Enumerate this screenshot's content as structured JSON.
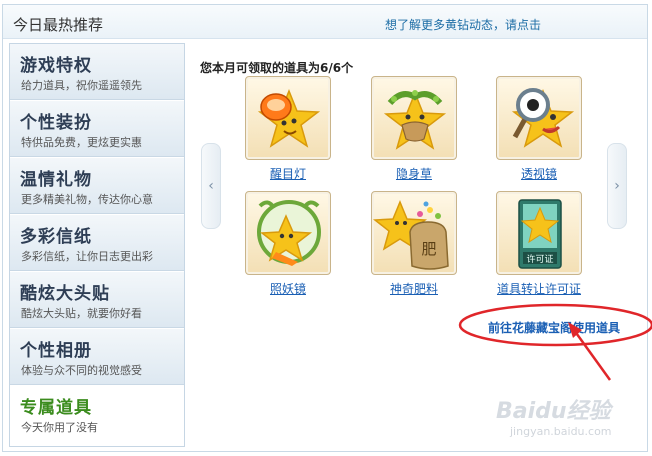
{
  "header": {
    "title": "今日最热推荐",
    "link": "想了解更多黄钻动态，请点击"
  },
  "sidebar": {
    "items": [
      {
        "title": "游戏特权",
        "sub": "给力道具，祝你遥遥领先"
      },
      {
        "title": "个性装扮",
        "sub": "特供品免费，更炫更实惠"
      },
      {
        "title": "温情礼物",
        "sub": "更多精美礼物，传达你心意"
      },
      {
        "title": "多彩信纸",
        "sub": "多彩信纸，让你日志更出彩"
      },
      {
        "title": "酷炫大头贴",
        "sub": "酷炫大头贴，就要你好看"
      },
      {
        "title": "个性相册",
        "sub": "体验与众不同的视觉感受"
      },
      {
        "title": "专属道具",
        "sub": "今天你用了没有"
      }
    ]
  },
  "main": {
    "quota": "您本月可领取的道具为6/6个",
    "prev_icon": "chevron-left-icon",
    "next_icon": "chevron-right-icon",
    "prev_glyph": "‹",
    "next_glyph": "›",
    "items": [
      {
        "label": "醒目灯",
        "icon": "spotlight-star-icon"
      },
      {
        "label": "隐身草",
        "icon": "grass-star-icon"
      },
      {
        "label": "透视镜",
        "icon": "magnifier-star-icon"
      },
      {
        "label": "照妖镜",
        "icon": "mirror-star-icon"
      },
      {
        "label": "神奇肥料",
        "icon": "fertilizer-star-icon"
      },
      {
        "label": "道具转让许可证",
        "icon": "license-star-icon"
      }
    ],
    "goto_link": "前往花藤藏宝阁使用道具",
    "fertilizer_char": "肥",
    "license_text": "许可证"
  },
  "watermark": {
    "text": "Baidu经验",
    "url": "jingyan.baidu.com"
  },
  "colors": {
    "link": "#1a5fb4",
    "star": "#f6c21a",
    "annotation": "#e0262a",
    "active_title": "#3b8c1e"
  }
}
